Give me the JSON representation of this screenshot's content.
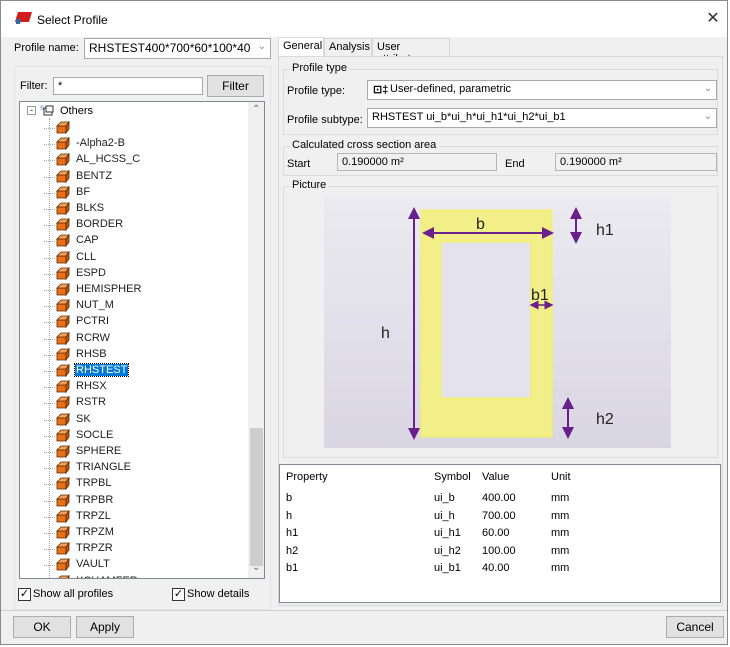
{
  "window": {
    "title": "Select Profile",
    "close_icon": "close-icon"
  },
  "profile_name": {
    "label": "Profile name:",
    "value": "RHSTEST400*700*60*100*40"
  },
  "filter": {
    "label": "Filter:",
    "value": "*",
    "button": "Filter"
  },
  "tree": {
    "root": "Others",
    "selected": "RHSTEST",
    "items": [
      "",
      "-Alpha2-B",
      "AL_HCSS_C",
      "BENTZ",
      "BF",
      "BLKS",
      "BORDER",
      "CAP",
      "CLL",
      "ESPD",
      "HEMISPHER",
      "NUT_M",
      "PCTRI",
      "RCRW",
      "RHSB",
      "RHSTEST",
      "RHSX",
      "RSTR",
      "SK",
      "SOCLE",
      "SPHERE",
      "TRIANGLE",
      "TRPBL",
      "TRPBR",
      "TRPZL",
      "TRPZM",
      "TRPZR",
      "VAULT",
      "XCHAMFER"
    ],
    "icon_color": "#e8701a"
  },
  "checkboxes": {
    "show_all": {
      "label": "Show all profiles",
      "checked": true
    },
    "show_details": {
      "label": "Show details",
      "checked": true
    }
  },
  "tabs": [
    {
      "label": "General",
      "active": true
    },
    {
      "label": "Analysis"
    },
    {
      "label": "User attributes"
    }
  ],
  "profile_type": {
    "group": "Profile type",
    "type_label": "Profile type:",
    "type_value": "User-defined, parametric",
    "subtype_label": "Profile subtype:",
    "subtype_value": "RHSTEST ui_b*ui_h*ui_h1*ui_h2*ui_b1"
  },
  "area": {
    "group": "Calculated cross section area",
    "start_label": "Start",
    "start_value": "0.190000 m²",
    "end_label": "End",
    "end_value": "0.190000 m²"
  },
  "picture": {
    "group": "Picture",
    "labels": {
      "b": "b",
      "h": "h",
      "h1": "h1",
      "h2": "h2",
      "b1": "b1"
    },
    "fill_color": "#f2ee88",
    "dim_color": "#6a1f8a"
  },
  "table": {
    "headers": [
      "Property",
      "Symbol",
      "Value",
      "Unit"
    ],
    "rows": [
      [
        "b",
        "ui_b",
        "400.00",
        "mm"
      ],
      [
        "h",
        "ui_h",
        "700.00",
        "mm"
      ],
      [
        "h1",
        "ui_h1",
        "60.00",
        "mm"
      ],
      [
        "h2",
        "ui_h2",
        "100.00",
        "mm"
      ],
      [
        "b1",
        "ui_b1",
        "40.00",
        "mm"
      ]
    ]
  },
  "buttons": {
    "ok": "OK",
    "apply": "Apply",
    "cancel": "Cancel"
  }
}
